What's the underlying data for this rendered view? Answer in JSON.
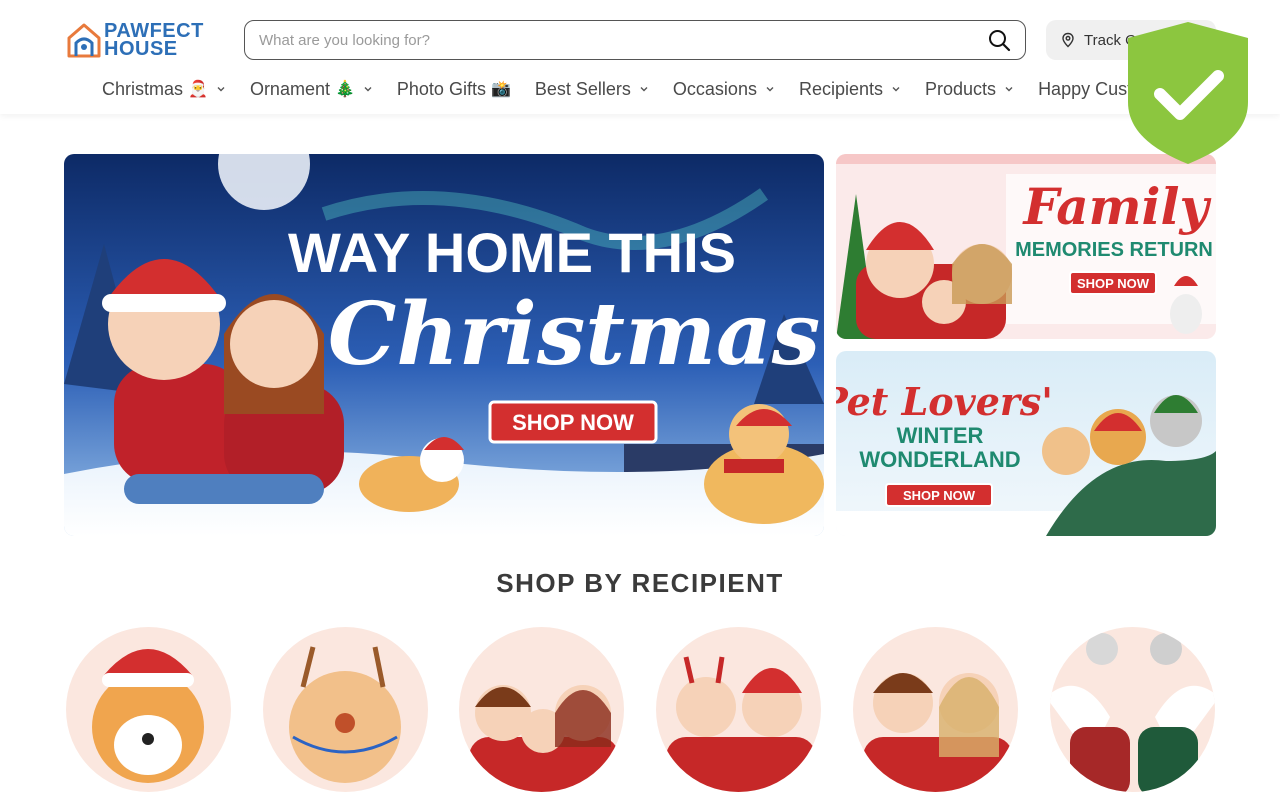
{
  "logo": {
    "line1": "PAWFECT",
    "line2": "HOUSE"
  },
  "search": {
    "placeholder": "What are you looking for?"
  },
  "track": {
    "label": "Track O"
  },
  "nav": [
    {
      "label": "Christmas",
      "emoji": "🎅",
      "chevron": true
    },
    {
      "label": "Ornament",
      "emoji": "🎄",
      "chevron": true
    },
    {
      "label": "Photo Gifts",
      "emoji": "📸",
      "chevron": false
    },
    {
      "label": "Best Sellers",
      "emoji": "",
      "chevron": true
    },
    {
      "label": "Occasions",
      "emoji": "",
      "chevron": true
    },
    {
      "label": "Recipients",
      "emoji": "",
      "chevron": true
    },
    {
      "label": "Products",
      "emoji": "",
      "chevron": true
    },
    {
      "label": "Happy Cust",
      "emoji": "",
      "chevron": false
    }
  ],
  "hero": {
    "line1": "WAY HOME THIS",
    "line2": "Christmas",
    "cta": "SHOP NOW"
  },
  "side1": {
    "line1": "Family",
    "line2": "MEMORIES RETURN",
    "cta": "SHOP NOW"
  },
  "side2": {
    "line1": "Pet Lovers'",
    "line2": "WINTER",
    "line3": "WONDERLAND",
    "cta": "SHOP NOW"
  },
  "section": {
    "title": "SHOP BY RECIPIENT"
  },
  "colors": {
    "brand": "#2d6fb7",
    "accent": "#e87a3c",
    "shield": "#8cc63f",
    "cta_red": "#d32f2f",
    "recipient_bg": "#fbe7df"
  },
  "icons": {
    "search": "search-icon",
    "track": "map-pin-icon",
    "shield": "shield-check-icon",
    "chevron": "chevron-down-icon"
  }
}
